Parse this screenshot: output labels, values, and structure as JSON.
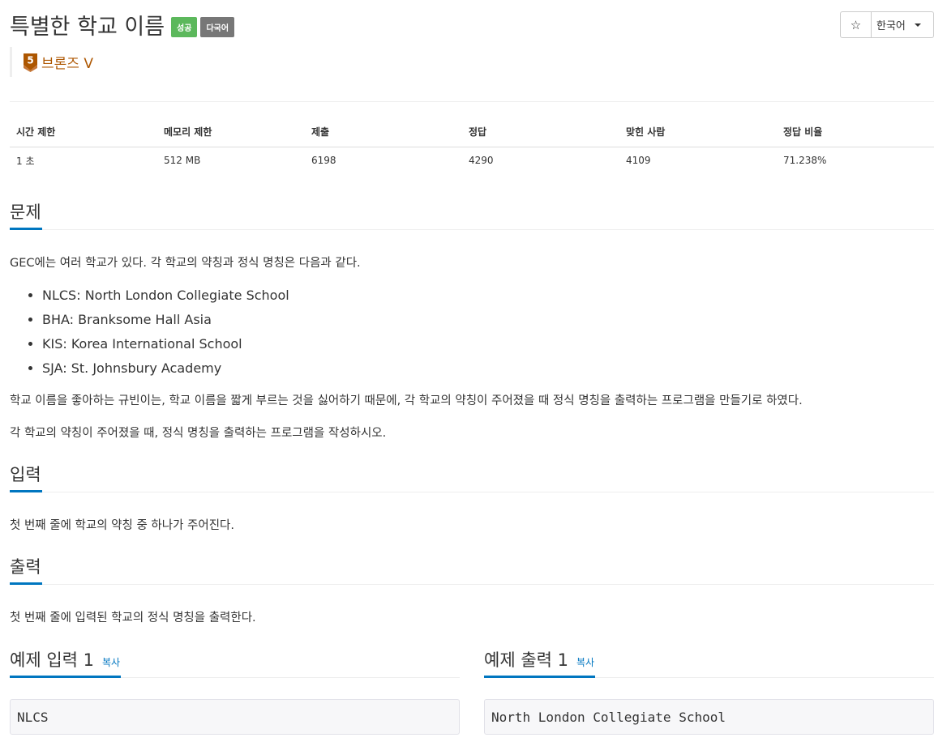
{
  "problem": {
    "title": "특별한 학교 이름",
    "labels": [
      "성공",
      "다국어"
    ],
    "tier": "브론즈 V",
    "tier_level": "5"
  },
  "toolbar": {
    "star_icon": "star-icon",
    "language": "한국어"
  },
  "info_table": {
    "headers": [
      "시간 제한",
      "메모리 제한",
      "제출",
      "정답",
      "맞힌 사람",
      "정답 비율"
    ],
    "values": [
      "1 초",
      "512 MB",
      "6198",
      "4290",
      "4109",
      "71.238%"
    ]
  },
  "sections": {
    "description": {
      "heading": "문제",
      "intro": "GEC에는 여러 학교가 있다. 각 학교의 약칭과 정식 명칭은 다음과 같다.",
      "items": [
        "NLCS: North London Collegiate School",
        "BHA: Branksome Hall Asia",
        "KIS: Korea International School",
        "SJA: St. Johnsbury Academy"
      ],
      "para2": "학교 이름을 좋아하는 규빈이는, 학교 이름을 짧게 부르는 것을 싫어하기 때문에, 각 학교의 약칭이 주어졌을 때 정식 명칭을 출력하는 프로그램을 만들기로 하였다.",
      "para3": "각 학교의 약칭이 주어졌을 때, 정식 명칭을 출력하는 프로그램을 작성하시오."
    },
    "input": {
      "heading": "입력",
      "text": "첫 번째 줄에 학교의 약칭 중 하나가 주어진다."
    },
    "output": {
      "heading": "출력",
      "text": "첫 번째 줄에 입력된 학교의 정식 명칭을 출력한다."
    }
  },
  "samples": {
    "input_heading": "예제 입력 1",
    "output_heading": "예제 출력 1",
    "copy_label": "복사",
    "input_value": "NLCS",
    "output_value": "North London Collegiate School"
  },
  "colors": {
    "accent": "#0076c0",
    "success_label": "#5cb85c",
    "default_label": "#777777",
    "tier_bronze": "#ad5600"
  }
}
